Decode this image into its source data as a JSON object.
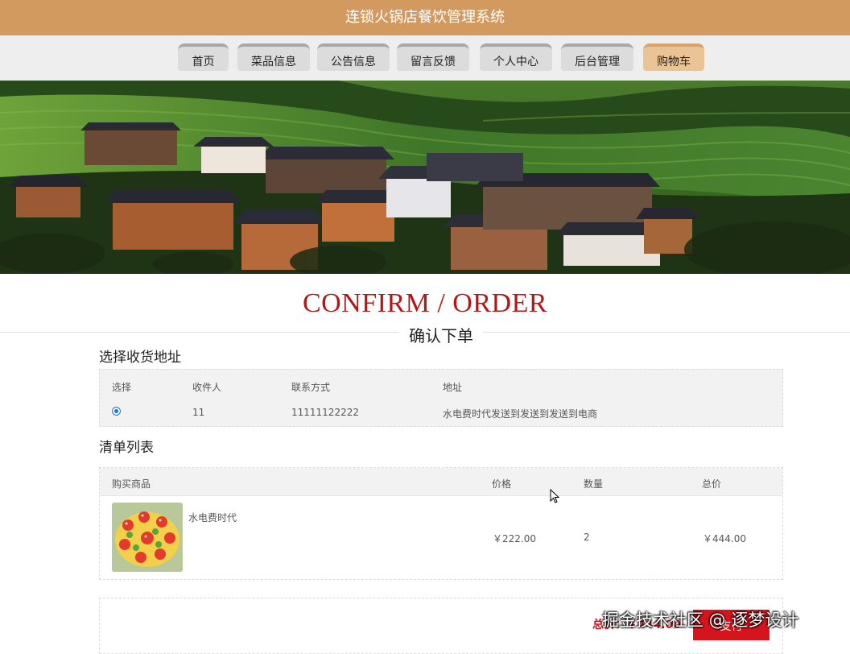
{
  "app": {
    "title": "连锁火锅店餐饮管理系统"
  },
  "nav": {
    "items": [
      {
        "label": "首页"
      },
      {
        "label": "菜品信息"
      },
      {
        "label": "公告信息"
      },
      {
        "label": "留言反馈"
      },
      {
        "label": "个人中心"
      },
      {
        "label": "后台管理"
      },
      {
        "label": "购物车",
        "active": true
      }
    ]
  },
  "page": {
    "title_en": "CONFIRM / ORDER",
    "title_cn": "确认下单"
  },
  "address": {
    "section_title": "选择收货地址",
    "headers": [
      "选择",
      "收件人",
      "联系方式",
      "地址"
    ],
    "rows": [
      {
        "selected": true,
        "recipient": "11",
        "phone": "11111122222",
        "address": "水电费时代发送到发送到发送到电商"
      }
    ]
  },
  "cart": {
    "section_title": "清单列表",
    "headers": [
      "购买商品",
      "价格",
      "数量",
      "总价"
    ],
    "items": [
      {
        "name": "水电费时代",
        "price": "￥222.00",
        "quantity": "2",
        "total": "￥444.00"
      }
    ]
  },
  "summary": {
    "total_label": "总价：￥444.00",
    "pay_label": "支付"
  },
  "watermark": "掘金技术社区 @ 逐梦设计",
  "colors": {
    "header_bg": "#d39a60",
    "accent_red": "#b21818",
    "pay_button": "#d7141c",
    "radio_blue": "#1a73e8"
  }
}
